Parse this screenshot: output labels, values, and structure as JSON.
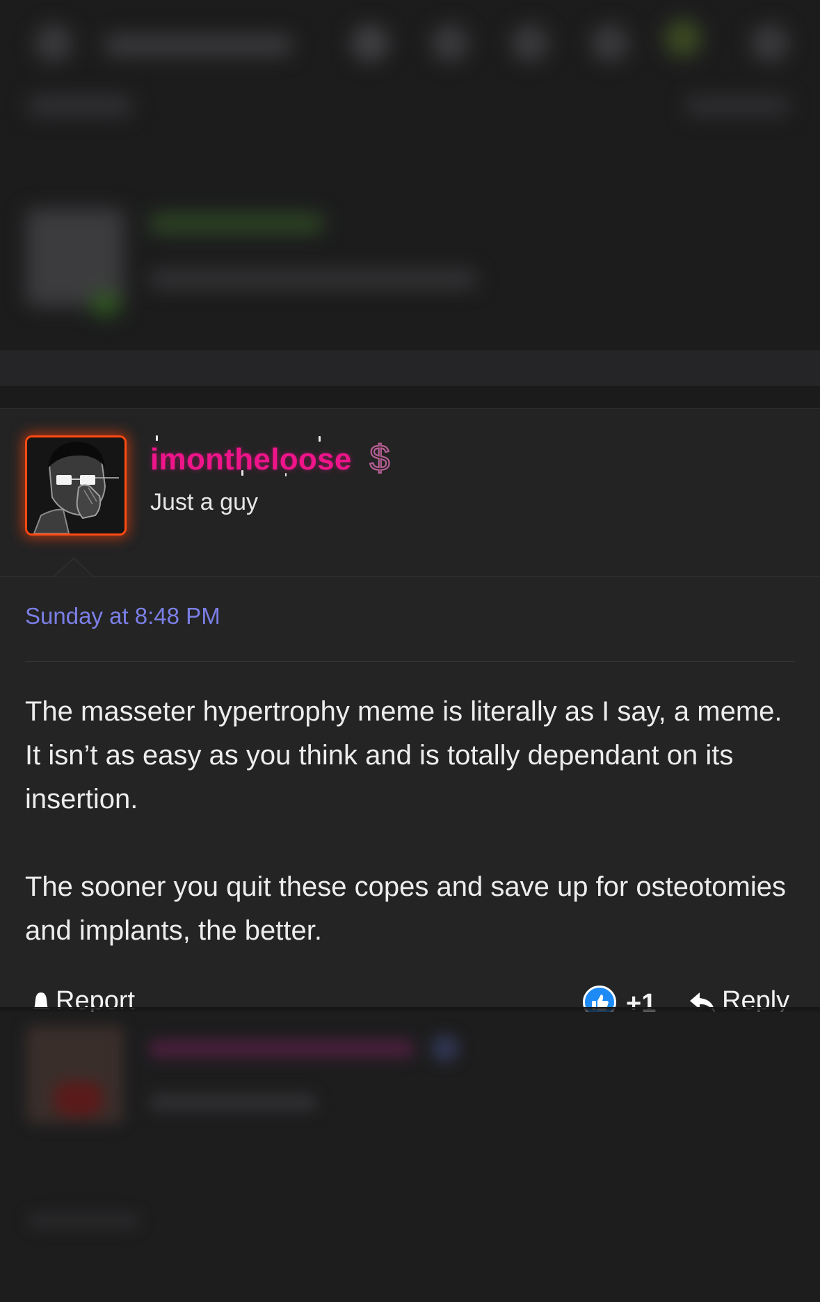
{
  "post": {
    "username": "imontheloose",
    "user_title": "Just a guy",
    "timestamp": "Sunday at 8:48 PM",
    "paragraphs": [
      "The masseter hypertrophy meme is literally as I say, a meme. It isn’t as easy as you think and is totally dependant on its insertion.",
      "The sooner you quit these copes and save up for osteotomies and implants, the better."
    ],
    "actions": {
      "report_label": "Report",
      "reaction_count": "+1",
      "reply_label": "Reply"
    },
    "icons": {
      "badge": "dollar-icon",
      "report": "bell-icon",
      "reaction": "thumbs-up-icon",
      "reply": "reply-arrow-icon"
    }
  },
  "colors": {
    "username": "#f0148a",
    "timestamp": "#7b7fe6",
    "avatar_border": "#ff4a12",
    "like_badge": "#1d8af6"
  }
}
